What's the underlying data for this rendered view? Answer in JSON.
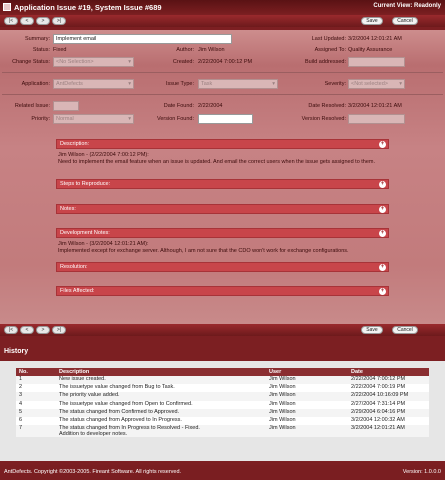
{
  "window": {
    "title": "Application Issue #19, System Issue #689",
    "view_mode": "Current View: Readonly"
  },
  "toolbar": {
    "first": "|<",
    "prev": "<",
    "next": ">",
    "last": ">|",
    "save_label": "Save",
    "cancel_label": "Cancel"
  },
  "form": {
    "summary_label": "Summary:",
    "summary_value": "Implement email",
    "last_updated_label": "Last Updated:",
    "last_updated_value": "3/2/2004 12:01:21 AM",
    "status_label": "Status:",
    "status_value": "Fixed",
    "author_label": "Author:",
    "author_value": "Jim Wilson",
    "assigned_label": "Assigned To:",
    "assigned_value": "Quality Assurance",
    "change_status_label": "Change Status:",
    "change_status_value": "<No Selection>",
    "created_label": "Created:",
    "created_value": "2/22/2004 7:00:12 PM",
    "build_label": "Build addressed:",
    "build_value": "",
    "application_label": "Application:",
    "application_value": "AntDefects",
    "issue_type_label": "Issue Type:",
    "issue_type_value": "Task",
    "severity_label": "Severity:",
    "severity_value": "<Not selected>",
    "related_label": "Related Issue:",
    "related_value": "",
    "date_found_label": "Date Found:",
    "date_found_value": "2/22/2004",
    "date_resolved_label": "Date Resolved:",
    "date_resolved_value": "3/2/2004 12:01:21 AM",
    "priority_label": "Priority:",
    "priority_value": "Normal",
    "version_found_label": "Version Found:",
    "version_found_value": "",
    "version_resolved_label": "Version Resolved:",
    "version_resolved_value": ""
  },
  "sections": {
    "description": "Description:",
    "description_meta": "Jim Wilson - (2/22/2004 7:00:12 PM):",
    "description_text": "Need to implement the email feature when an issue is updated. And email the correct users when the issue gets assigned to them.",
    "steps": "Steps to Reproduce:",
    "notes": "Notes:",
    "dev_notes": "Development Notes:",
    "dev_meta": "Jim Wilson - (3/2/2004 12:01:21 AM):",
    "dev_text": "Implemented except for exchange server. Although, I am not sure that the CDO won't work for exchange configurations.",
    "resolution": "Resolution:",
    "files": "Files Affected:"
  },
  "history": {
    "title": "History",
    "columns": [
      "No.",
      "Description",
      "User",
      "Date"
    ],
    "rows": [
      {
        "no": "1",
        "desc": "New issue created.",
        "user": "Jim Wilson",
        "date": "2/22/2004 7:00:12 PM"
      },
      {
        "no": "2",
        "desc": "The issuetype value changed from Bug to Task.",
        "user": "Jim Wilson",
        "date": "2/22/2004 7:00:19 PM"
      },
      {
        "no": "3",
        "desc": "The priority value added.",
        "user": "Jim Wilson",
        "date": "2/22/2004 10:16:09 PM"
      },
      {
        "no": "4",
        "desc": "The issuetype value changed from Open to Confirmed.",
        "user": "Jim Wilson",
        "date": "2/27/2004 7:31:14 PM"
      },
      {
        "no": "5",
        "desc": "The status changed from Confirmed to Approved.",
        "user": "Jim Wilson",
        "date": "2/29/2004 6:04:16 PM"
      },
      {
        "no": "6",
        "desc": "The status changed from Approved to In Progress.",
        "user": "Jim Wilson",
        "date": "3/2/2004 12:00:32 AM"
      },
      {
        "no": "7",
        "desc": "The status changed from In Progress to Resolved - Fixed.",
        "desc2": "Addition to developer notes.",
        "user": "Jim Wilson",
        "date": "3/2/2004 12:01:21 AM"
      }
    ]
  },
  "footer": {
    "copyright": "AntDefects. Copyright ©2003-2005. Fireant Software. All rights reserved.",
    "version": "Version: 1.0.0.0"
  }
}
